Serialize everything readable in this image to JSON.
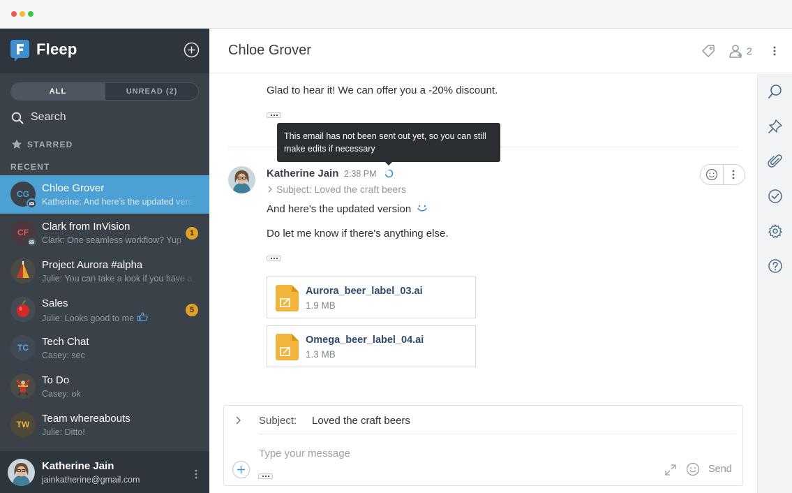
{
  "window": {
    "dots": [
      "#f25b52",
      "#f5b83a",
      "#33c748"
    ]
  },
  "colors": {
    "active_row": "#4ca0d3",
    "sidebar": "#3a4149",
    "unread_badge": "#e1a128",
    "file_icon": "#f3b43c",
    "link_blue": "#2b4a6b"
  },
  "sidebar": {
    "logo_icon": "fleep-logo-icon",
    "logo_text": "Fleep",
    "tabs": [
      {
        "label": "ALL",
        "active": true
      },
      {
        "label": "UNREAD (2)",
        "active": false
      }
    ],
    "search_label": "Search",
    "starred_label": "STARRED",
    "recent_label": "RECENT",
    "conversations": [
      {
        "name": "Chloe Grover",
        "snippet": "Katherine: And here's the updated version",
        "avatar_text": "CG",
        "avatar_bg": "#3a4149",
        "avatar_color": "#4ca0d3",
        "active": true,
        "email": true,
        "unread": ""
      },
      {
        "name": "Clark from InVision",
        "snippet": "Clark: One seamless workflow? Yup",
        "avatar_text": "CF",
        "avatar_bg": "#4a3a3f",
        "avatar_color": "#e05a5a",
        "active": false,
        "email": true,
        "unread": "1"
      },
      {
        "name": "Project Aurora #alpha",
        "snippet": "Julie: You can take a look if you have a minute",
        "avatar_text": "",
        "avatar_bg": "#4b4a45",
        "avatar_color": "#ffffff",
        "active": false,
        "email": false,
        "unread": ""
      },
      {
        "name": "Sales",
        "snippet": "Julie: Looks good to me",
        "avatar_text": "",
        "avatar_bg": "#454b52",
        "avatar_color": "#ffffff",
        "active": false,
        "email": false,
        "unread": "5"
      },
      {
        "name": "Tech Chat",
        "snippet": "Casey: sec",
        "avatar_text": "TC",
        "avatar_bg": "#404a57",
        "avatar_color": "#5aa3e0",
        "active": false,
        "email": false,
        "unread": ""
      },
      {
        "name": "To Do",
        "snippet": "Casey: ok",
        "avatar_text": "",
        "avatar_bg": "#4b4a45",
        "avatar_color": "#ffffff",
        "active": false,
        "email": false,
        "unread": ""
      },
      {
        "name": "Team whereabouts",
        "snippet": "Julie: Ditto!",
        "avatar_text": "TW",
        "avatar_bg": "#4d4838",
        "avatar_color": "#e7b33d",
        "active": false,
        "email": false,
        "unread": ""
      }
    ],
    "me": {
      "name": "Katherine Jain",
      "email": "jainkatherine@gmail.com"
    }
  },
  "header": {
    "title": "Chloe Grover",
    "members_count": "2"
  },
  "messages": {
    "prev_text": "Glad to hear it! We can offer you a -20% discount.",
    "tooltip": "This email has not been sent out yet, so you can still make edits if necessary",
    "sender": "Katherine Jain",
    "time": "2:38 PM",
    "subject": "Subject: Loved the craft beers",
    "line1": "And here's the updated version",
    "line2": "Do let me know if there's anything else.",
    "files": [
      {
        "name": "Aurora_beer_label_03.ai",
        "size": "1.9 MB"
      },
      {
        "name": "Omega_beer_label_04.ai",
        "size": "1.3 MB"
      }
    ]
  },
  "composer": {
    "subject_label": "Subject:",
    "subject_value": "Loved the craft beers",
    "placeholder": "Type your message",
    "send_label": "Send"
  }
}
